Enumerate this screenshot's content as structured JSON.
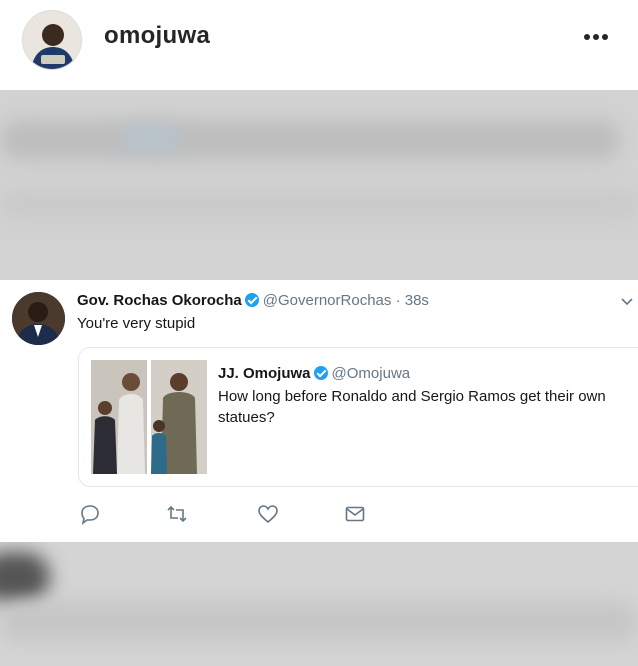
{
  "instagram": {
    "username": "omojuwa",
    "more_icon": "more-dots-icon"
  },
  "tweet": {
    "author_name": "Gov. Rochas Okorocha",
    "handle": "@GovernorRochas",
    "separator": "·",
    "time": "38s",
    "text": "You're very stupid",
    "quoted": {
      "author_name": "JJ. Omojuwa",
      "handle": "@Omojuwa",
      "text": "How long  before Ronaldo and Sergio Ramos get their own statues?"
    },
    "actions": [
      "reply-icon",
      "retweet-icon",
      "like-icon",
      "direct-message-icon"
    ]
  },
  "colors": {
    "verified": "#1da1f2",
    "secondary_text": "#657786",
    "blurred_background": "#d2d2d2"
  }
}
